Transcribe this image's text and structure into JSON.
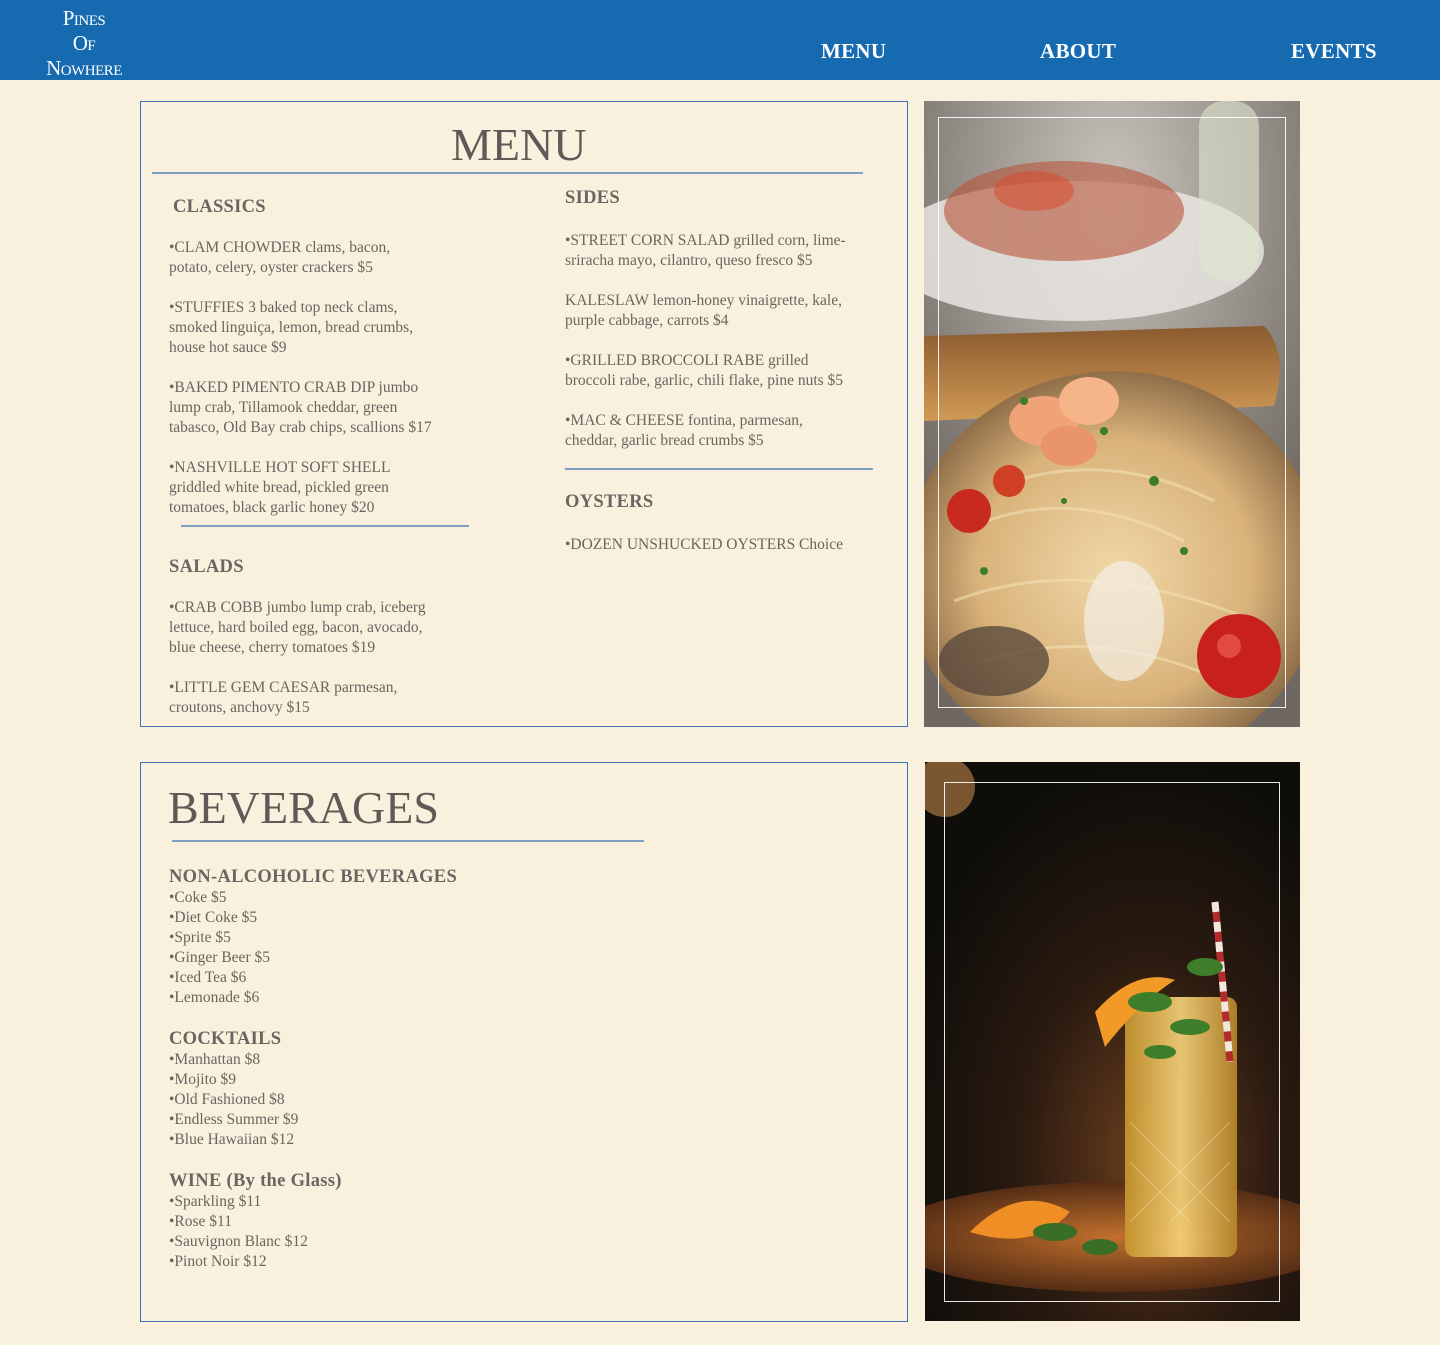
{
  "header": {
    "logo": {
      "line1": "Pines",
      "line2": "Of",
      "line3": "Nowhere"
    },
    "nav": [
      {
        "label": "MENU"
      },
      {
        "label": "ABOUT"
      },
      {
        "label": "EVENTS"
      }
    ]
  },
  "menu": {
    "title": "MENU",
    "classics": {
      "heading": "CLASSICS",
      "items": [
        [
          "•CLAM CHOWDER clams, bacon,",
          "potato, celery, oyster crackers $5"
        ],
        [
          "•STUFFIES 3 baked top neck clams,",
          "smoked linguiça, lemon, bread crumbs,",
          "house hot sauce $9"
        ],
        [
          "•BAKED PIMENTO CRAB DIP jumbo",
          "lump crab, Tillamook cheddar, green",
          "tabasco, Old Bay crab chips, scallions $17"
        ],
        [
          "•NASHVILLE HOT SOFT SHELL",
          "griddled white bread, pickled green",
          "tomatoes, black garlic honey $20"
        ]
      ]
    },
    "salads": {
      "heading": "SALADS",
      "items": [
        [
          "•CRAB COBB jumbo lump crab, iceberg",
          "lettuce, hard boiled egg, bacon, avocado,",
          "blue cheese, cherry tomatoes $19"
        ],
        [
          "•LITTLE GEM CAESAR parmesan,",
          "croutons, anchovy $15"
        ]
      ]
    },
    "sides": {
      "heading": "SIDES",
      "items": [
        [
          "•STREET CORN SALAD grilled corn, lime-",
          "sriracha mayo, cilantro, queso fresco $5"
        ],
        [
          "KALESLAW lemon-honey vinaigrette, kale,",
          "purple cabbage, carrots $4"
        ],
        [
          "•GRILLED BROCCOLI RABE grilled",
          "broccoli rabe, garlic, chili flake, pine nuts $5"
        ],
        [
          "•MAC & CHEESE fontina, parmesan,",
          "cheddar, garlic bread crumbs $5"
        ]
      ]
    },
    "oysters": {
      "heading": "OYSTERS",
      "items": [
        [
          "•DOZEN UNSHUCKED OYSTERS Choice"
        ]
      ]
    }
  },
  "beverages": {
    "title": "BEVERAGES",
    "non_alcoholic": {
      "heading": "NON-ALCOHOLIC BEVERAGES",
      "items": [
        "•Coke $5",
        "•Diet Coke $5",
        "•Sprite $5",
        "•Ginger Beer $5",
        "•Iced Tea $6",
        "•Lemonade $6"
      ]
    },
    "cocktails": {
      "heading": "COCKTAILS",
      "items": [
        "•Manhattan $8",
        "•Mojito $9",
        "•Old Fashioned $8",
        "•Endless Summer $9",
        "•Blue Hawaiian $12"
      ]
    },
    "wine": {
      "heading": "WINE (By the Glass)",
      "items": [
        "•Sparkling $11",
        "•Rose $11",
        "•Sauvignon Blanc $12",
        "•Pinot Noir  $12"
      ]
    }
  },
  "colors": {
    "header_bg": "#166aaf",
    "page_bg": "#faf0de",
    "accent_rule": "#7d9fc6",
    "text": "#6a6560"
  }
}
